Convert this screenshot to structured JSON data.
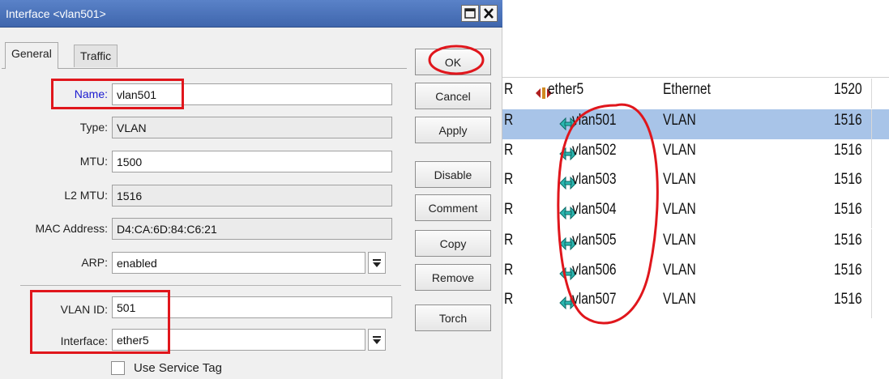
{
  "window": {
    "title": "Interface <vlan501>",
    "restore_icon": "restore-icon",
    "close_icon": "close-icon"
  },
  "tabs": [
    {
      "label": "General",
      "active": true
    },
    {
      "label": "Traffic",
      "active": false
    }
  ],
  "form": {
    "name": {
      "label": "Name:",
      "value": "vlan501"
    },
    "type": {
      "label": "Type:",
      "value": "VLAN"
    },
    "mtu": {
      "label": "MTU:",
      "value": "1500"
    },
    "l2mtu": {
      "label": "L2 MTU:",
      "value": "1516"
    },
    "mac": {
      "label": "MAC Address:",
      "value": "D4:CA:6D:84:C6:21"
    },
    "arp": {
      "label": "ARP:",
      "value": "enabled"
    },
    "vlan_id": {
      "label": "VLAN ID:",
      "value": "501"
    },
    "interface": {
      "label": "Interface:",
      "value": "ether5"
    },
    "use_service_tag": {
      "label": "Use Service Tag",
      "checked": false
    }
  },
  "buttons": {
    "ok": "OK",
    "cancel": "Cancel",
    "apply": "Apply",
    "disable": "Disable",
    "comment": "Comment",
    "copy": "Copy",
    "remove": "Remove",
    "torch": "Torch"
  },
  "interface_list": {
    "rows": [
      {
        "flag": "R",
        "name": "ether5",
        "type": "Ethernet",
        "mtu": "1520",
        "selected": false,
        "kind": "ethernet"
      },
      {
        "flag": "R",
        "name": "vlan501",
        "type": "VLAN",
        "mtu": "1516",
        "selected": true,
        "kind": "vlan"
      },
      {
        "flag": "R",
        "name": "vlan502",
        "type": "VLAN",
        "mtu": "1516",
        "selected": false,
        "kind": "vlan"
      },
      {
        "flag": "R",
        "name": "vlan503",
        "type": "VLAN",
        "mtu": "1516",
        "selected": false,
        "kind": "vlan"
      },
      {
        "flag": "R",
        "name": "vlan504",
        "type": "VLAN",
        "mtu": "1516",
        "selected": false,
        "kind": "vlan"
      },
      {
        "flag": "R",
        "name": "vlan505",
        "type": "VLAN",
        "mtu": "1516",
        "selected": false,
        "kind": "vlan"
      },
      {
        "flag": "R",
        "name": "vlan506",
        "type": "VLAN",
        "mtu": "1516",
        "selected": false,
        "kind": "vlan"
      },
      {
        "flag": "R",
        "name": "vlan507",
        "type": "VLAN",
        "mtu": "1516",
        "selected": false,
        "kind": "vlan"
      }
    ]
  },
  "colors": {
    "titlebar": "#4a72bc",
    "selection": "#a8c4e8",
    "annotation_red": "#e0161c",
    "vlan_icon": "#2bb7b0",
    "ethernet_icon": "#b02020"
  }
}
